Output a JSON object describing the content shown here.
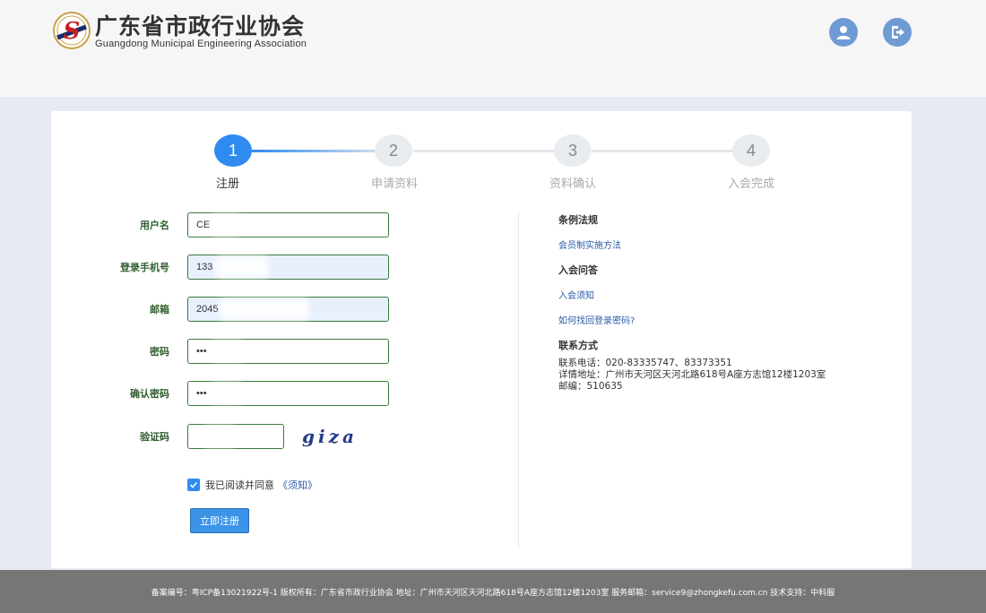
{
  "header": {
    "title": "广东省市政行业协会",
    "subtitle": "Guangdong Municipal Engineering Association",
    "logo_letter": "S",
    "user_icon": "user-icon",
    "logout_icon": "logout-icon"
  },
  "steps": [
    {
      "num": "1",
      "label": "注册",
      "active": true
    },
    {
      "num": "2",
      "label": "申请资料",
      "active": false
    },
    {
      "num": "3",
      "label": "资料确认",
      "active": false
    },
    {
      "num": "4",
      "label": "入会完成",
      "active": false
    }
  ],
  "form": {
    "username": {
      "label": "用户名",
      "value": "CE"
    },
    "phone": {
      "label": "登录手机号",
      "value": "133"
    },
    "email": {
      "label": "邮箱",
      "value": "2045"
    },
    "password": {
      "label": "密码",
      "value": "•••"
    },
    "confirm": {
      "label": "确认密码",
      "value": "•••"
    },
    "captcha": {
      "label": "验证码",
      "value": "",
      "image_text": "giza"
    },
    "agree_text": "我已阅读并同意",
    "agree_link": "《须知》",
    "agree_checked": true,
    "submit": "立即注册"
  },
  "side": {
    "rules_heading": "条例法规",
    "rules_link": "会员制实施方法",
    "faq_heading": "入会问答",
    "faq_link1": "入会须知",
    "faq_link2": "如何找回登录密码?",
    "contact_heading": "联系方式",
    "contact_phone": "联系电话：020-83335747、83373351",
    "contact_address": "详情地址：广州市天河区天河北路618号A座方志馆12楼1203室",
    "contact_zip": "邮编：510635"
  },
  "footer": {
    "text": "备案编号：粤ICP备13021922号-1 版权所有：广东省市政行业协会 地址：广州市天河区天河北路618号A座方志馆12楼1203室 服务邮箱：service9@zhongkefu.com.cn 技术支持：中科服"
  },
  "colors": {
    "accent": "#2f8bf0",
    "label_green": "#2f5e2f",
    "header_icon": "#6f9bd4",
    "footer_bg": "#767676"
  }
}
